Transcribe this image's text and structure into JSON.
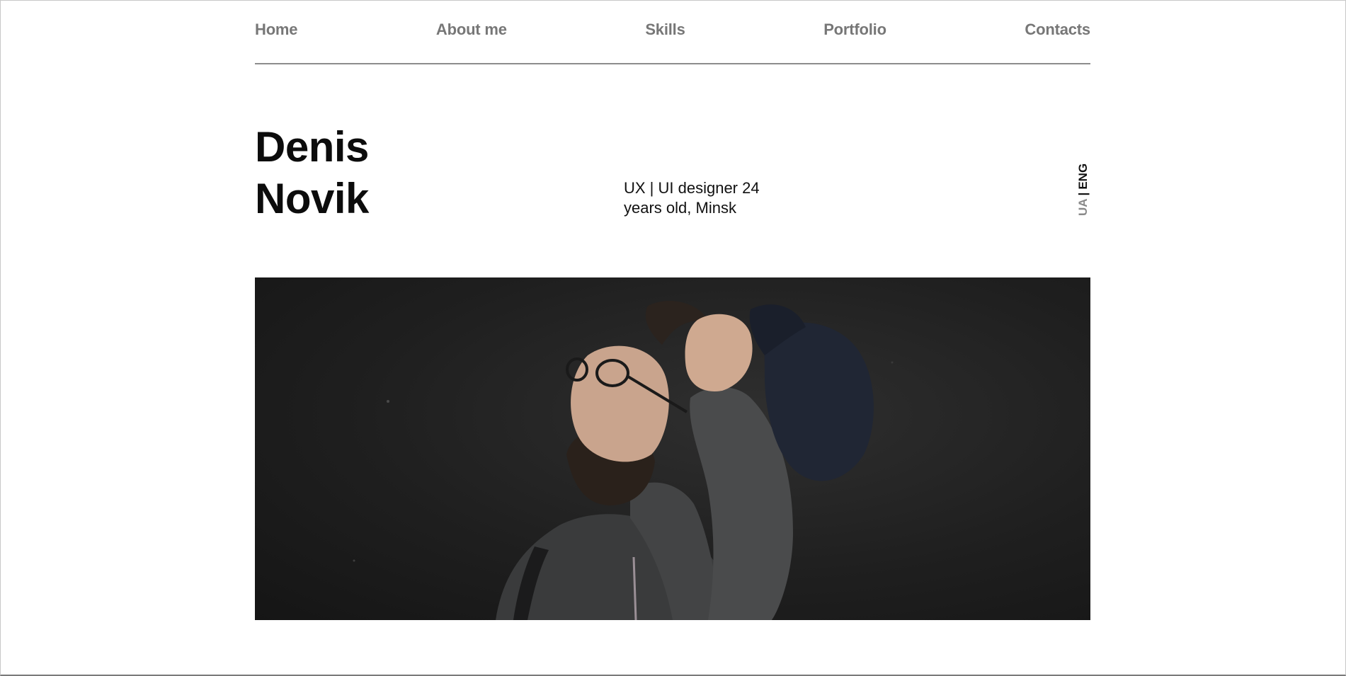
{
  "nav": {
    "items": [
      {
        "label": "Home"
      },
      {
        "label": "About me"
      },
      {
        "label": "Skills"
      },
      {
        "label": "Portfolio"
      },
      {
        "label": "Contacts"
      }
    ]
  },
  "hero": {
    "first_name": "Denis",
    "last_name": "Novik",
    "tagline": "UX | UI designer 24 years old, Minsk"
  },
  "language": {
    "ua": "UA",
    "separator": "|",
    "eng": "ENG",
    "active": "ENG"
  },
  "colors": {
    "nav_text": "#777777",
    "heading": "#0c0c0c",
    "photo_bg": "#1f1f1f"
  }
}
